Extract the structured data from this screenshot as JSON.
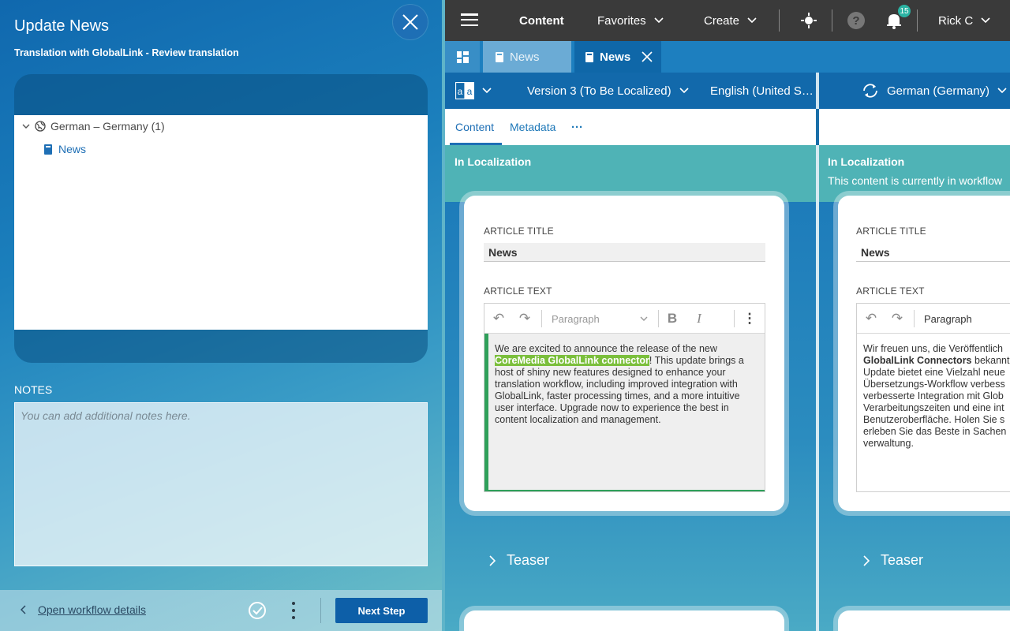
{
  "left_panel": {
    "title": "Update News",
    "subtitle": "Translation with GlobalLink - Review translation",
    "tree": {
      "language_node": "German – Germany (1)",
      "child_item": "News"
    },
    "notes_label": "NOTES",
    "notes_placeholder": "You can add additional notes here.",
    "footer": {
      "open_workflow_link": "Open workflow details",
      "next_step_button": "Next Step"
    }
  },
  "topbar": {
    "content": "Content",
    "favorites": "Favorites",
    "create": "Create",
    "notifications_count": "15",
    "user": "Rick C"
  },
  "tabs": [
    {
      "label": "News"
    },
    {
      "label": "News"
    }
  ],
  "toolbar_row": {
    "version": "Version 3 (To Be Localized)",
    "source_locale": "English (United S…",
    "target_locale": "German (Germany)"
  },
  "content_tabs": {
    "content": "Content",
    "metadata": "Metadata",
    "more": "···"
  },
  "left_column": {
    "status_title": "In Localization",
    "article_title_label": "ARTICLE TITLE",
    "article_title_value": "News",
    "article_text_label": "ARTICLE TEXT",
    "paragraph_select": "Paragraph",
    "text_before": "We are excited to announce the release of the new ",
    "text_highlight": "CoreMedia GlobalLink connector",
    "text_after": "! This update brings a host of shiny new features designed to enhance your translation workflow, including improved integration with GlobalLink, faster processing times, and a more intuitive user interface. Upgrade now to experience the best in content localization and management.",
    "teaser": "Teaser"
  },
  "right_column": {
    "status_title": "In Localization",
    "status_desc": "This content is currently in workflow",
    "article_title_label": "ARTICLE TITLE",
    "article_title_value": "News",
    "article_text_label": "ARTICLE TEXT",
    "paragraph_select": "Paragraph",
    "text_lines": [
      "Wir freuen uns, die Veröffentlich",
      "bekannt",
      "Update bietet eine Vielzahl neue",
      "Übersetzungs-Workflow verbess",
      "verbesserte Integration mit Glob",
      "Verarbeitungszeiten und eine int",
      "Benutzeroberfläche. Holen Sie s",
      "erleben Sie das Beste in Sachen",
      "verwaltung."
    ],
    "text_bold": "GlobalLink Connectors",
    "teaser": "Teaser"
  },
  "colors": {
    "topbar": "#3a3a3a",
    "accent_blue": "#0d5fa8",
    "status_teal": "#4fb3b6",
    "highlight_green": "#7bbf3c"
  }
}
